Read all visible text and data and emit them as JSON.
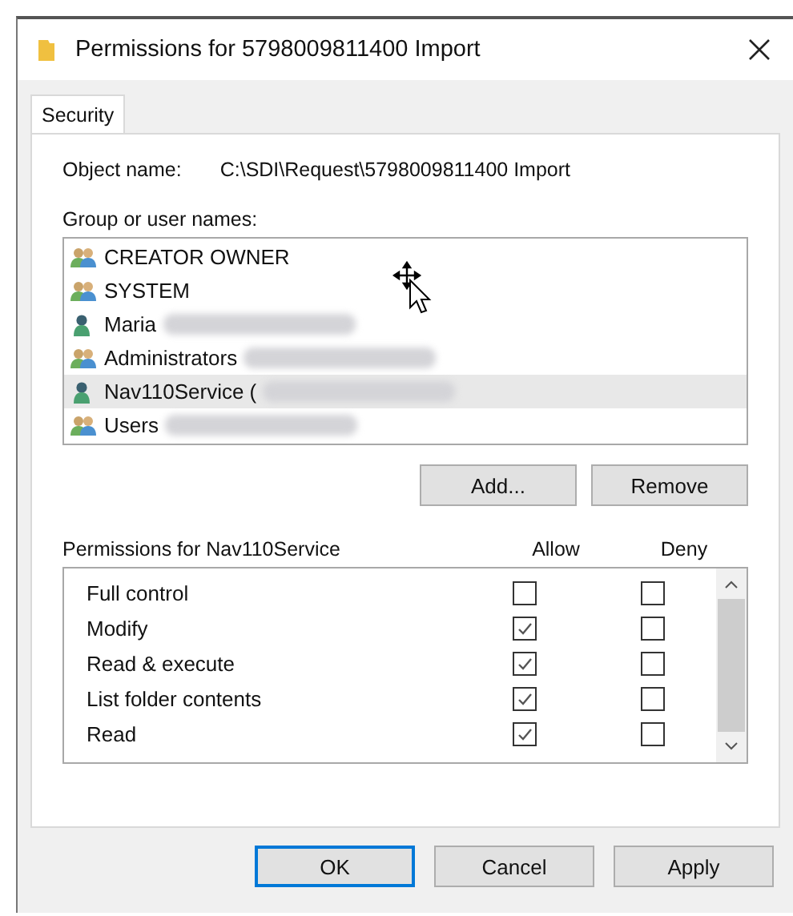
{
  "window": {
    "title": "Permissions for 5798009811400 Import"
  },
  "tabs": [
    {
      "label": "Security",
      "selected": true
    }
  ],
  "object_name": {
    "label": "Object name:",
    "value": "C:\\SDI\\Request\\5798009811400 Import"
  },
  "group_list": {
    "label": "Group or user names:",
    "items": [
      {
        "name": "CREATOR OWNER",
        "kind": "group",
        "redacted": false,
        "selected": false
      },
      {
        "name": "SYSTEM",
        "kind": "group",
        "redacted": false,
        "selected": false
      },
      {
        "name": "Maria",
        "kind": "user",
        "redacted": true,
        "selected": false
      },
      {
        "name": "Administrators",
        "kind": "group",
        "redacted": true,
        "selected": false
      },
      {
        "name": "Nav110Service (",
        "kind": "user",
        "redacted": true,
        "selected": true
      },
      {
        "name": "Users",
        "kind": "group",
        "redacted": true,
        "selected": false
      }
    ]
  },
  "list_buttons": [
    "Add...",
    "Remove"
  ],
  "permissions": {
    "label": "Permissions for Nav110Service",
    "allow_header": "Allow",
    "deny_header": "Deny",
    "rows": [
      {
        "name": "Full control",
        "allow": false,
        "deny": false
      },
      {
        "name": "Modify",
        "allow": true,
        "deny": false
      },
      {
        "name": "Read & execute",
        "allow": true,
        "deny": false
      },
      {
        "name": "List folder contents",
        "allow": true,
        "deny": false
      },
      {
        "name": "Read",
        "allow": true,
        "deny": false
      }
    ]
  },
  "buttons": [
    {
      "label": "OK",
      "default": true
    },
    {
      "label": "Cancel",
      "default": false
    },
    {
      "label": "Apply",
      "default": false
    }
  ]
}
